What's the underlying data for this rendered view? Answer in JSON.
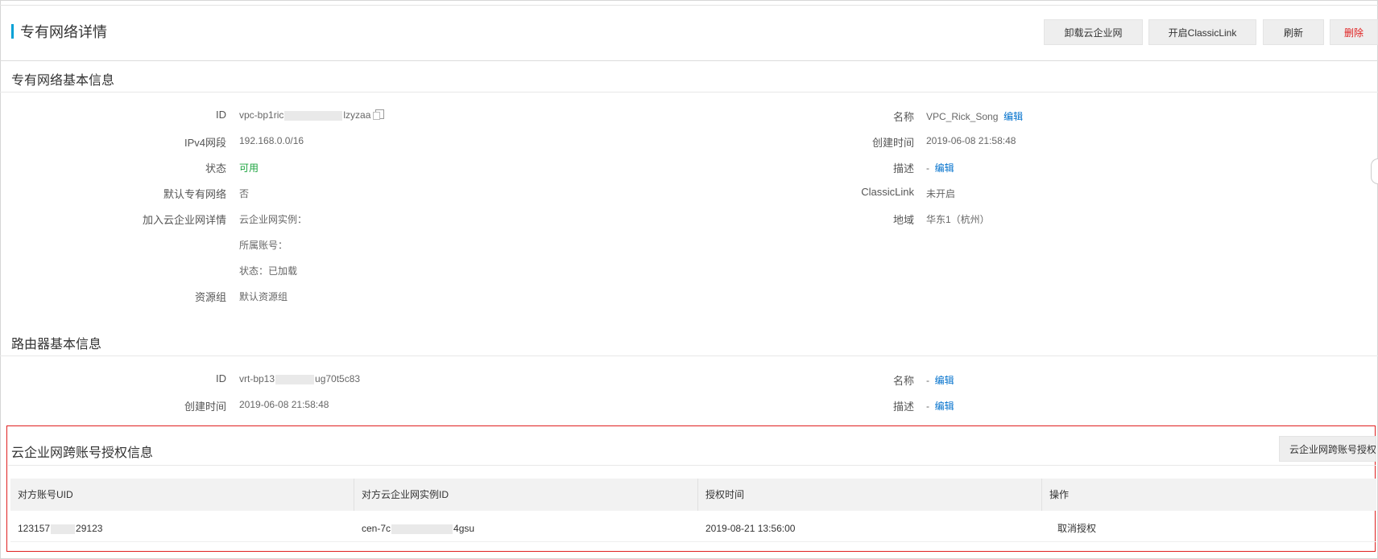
{
  "header": {
    "title": "专有网络详情",
    "buttons": {
      "detach_cen": "卸载云企业网",
      "enable_classiclink": "开启ClassicLink",
      "refresh": "刷新",
      "delete": "删除"
    }
  },
  "vpc_basic": {
    "section_title": "专有网络基本信息",
    "id_label": "ID",
    "id_prefix": "vpc-bp1ric",
    "id_suffix": "lzyzaa",
    "ipv4_label": "IPv4网段",
    "ipv4_value": "192.168.0.0/16",
    "status_label": "状态",
    "status_value": "可用",
    "default_vpc_label": "默认专有网络",
    "default_vpc_value": "否",
    "cen_label": "加入云企业网详情",
    "cen_instance": "云企业网实例：",
    "cen_account": "所属账号：",
    "cen_status": "状态：已加载",
    "resource_group_label": "资源组",
    "resource_group_value": "默认资源组",
    "name_label": "名称",
    "name_value": "VPC_Rick_Song",
    "edit": "编辑",
    "created_label": "创建时间",
    "created_value": "2019-06-08 21:58:48",
    "desc_label": "描述",
    "desc_value": "-",
    "classiclink_label": "ClassicLink",
    "classiclink_value": "未开启",
    "region_label": "地域",
    "region_value": "华东1（杭州）"
  },
  "router_basic": {
    "section_title": "路由器基本信息",
    "id_label": "ID",
    "id_prefix": "vrt-bp13",
    "id_suffix": "ug70t5c83",
    "created_label": "创建时间",
    "created_value": "2019-06-08 21:58:48",
    "name_label": "名称",
    "name_value": "-",
    "desc_label": "描述",
    "desc_value": "-",
    "edit": "编辑"
  },
  "cen_auth": {
    "section_title": "云企业网跨账号授权信息",
    "button_label": "云企业网跨账号授权",
    "columns": [
      "对方账号UID",
      "对方云企业网实例ID",
      "授权时间",
      "操作"
    ],
    "rows": [
      {
        "uid_prefix": "123157",
        "uid_suffix": "29123",
        "instance_prefix": "cen-7c",
        "instance_suffix": "4gsu",
        "time": "2019-08-21 13:56:00",
        "action": "取消授权"
      }
    ]
  },
  "colors": {
    "accent": "#00a1d6",
    "link": "#0070cc",
    "danger": "#e02020",
    "success": "#1ca33f"
  }
}
